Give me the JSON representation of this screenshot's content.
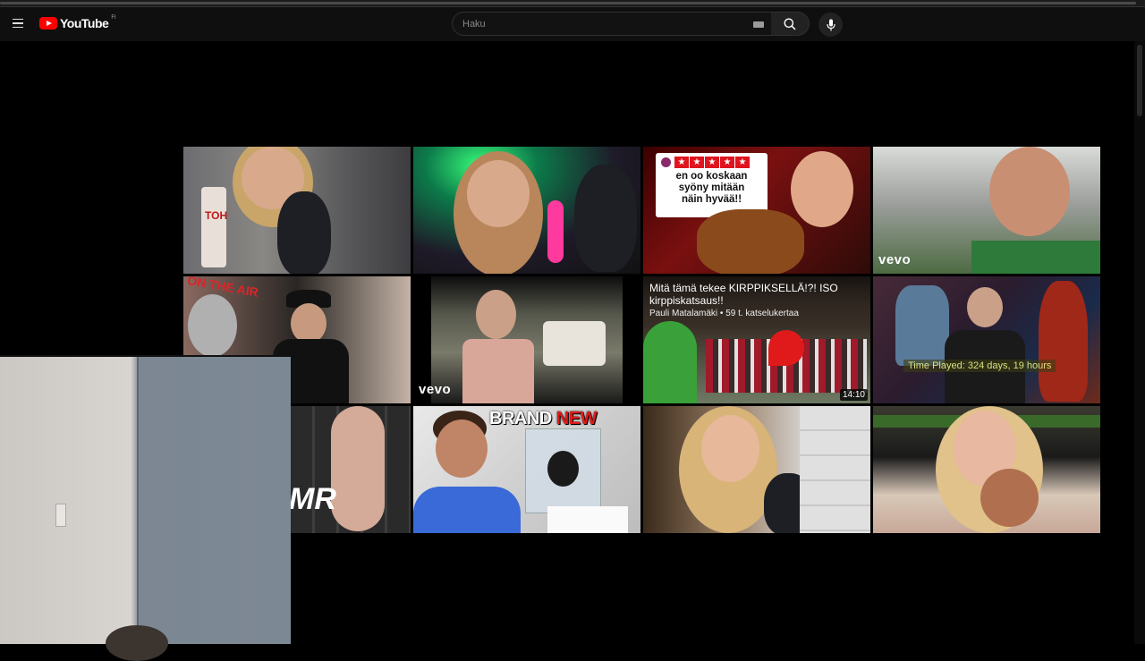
{
  "masthead": {
    "logo_text": "YouTube",
    "country_code": "FI",
    "search_placeholder": "Haku"
  },
  "videos": [
    {
      "label": "asmr-drink-girl",
      "text": "TOH"
    },
    {
      "label": "asmr-green-light-girl",
      "text": ""
    },
    {
      "label": "burger-review",
      "rating_lines": [
        "en oo koskaan",
        "syöny mitään",
        "näin hyvää!!"
      ],
      "stars": 5
    },
    {
      "label": "stadium-vevo",
      "badge": "vevo"
    },
    {
      "label": "on-the-air",
      "text": "ON THE AIR"
    },
    {
      "label": "station-wagon-vevo",
      "badge": "vevo"
    },
    {
      "label": "kirppis-video",
      "title": "Mitä tämä tekee KIRPPIKSELLÄ!?! ISO kirppiskatsaus!!",
      "meta": "Pauli Matalamäki • 59 t. katselukertaa",
      "duration": "14:10"
    },
    {
      "label": "runescape-video",
      "game_text": "Time Played: 324 days, 19 hours"
    },
    {
      "label": "asmr-keyboard",
      "text": "MR"
    },
    {
      "label": "brand-new-apple",
      "text_white": "BRAND ",
      "text_red": "NEW"
    },
    {
      "label": "asmr-blonde-mic",
      "text": ""
    },
    {
      "label": "asmr-brush-blonde",
      "text": ""
    }
  ],
  "colors": {
    "background": "#000000",
    "masthead": "#0f0f0f",
    "brand_red": "#ff0000"
  }
}
